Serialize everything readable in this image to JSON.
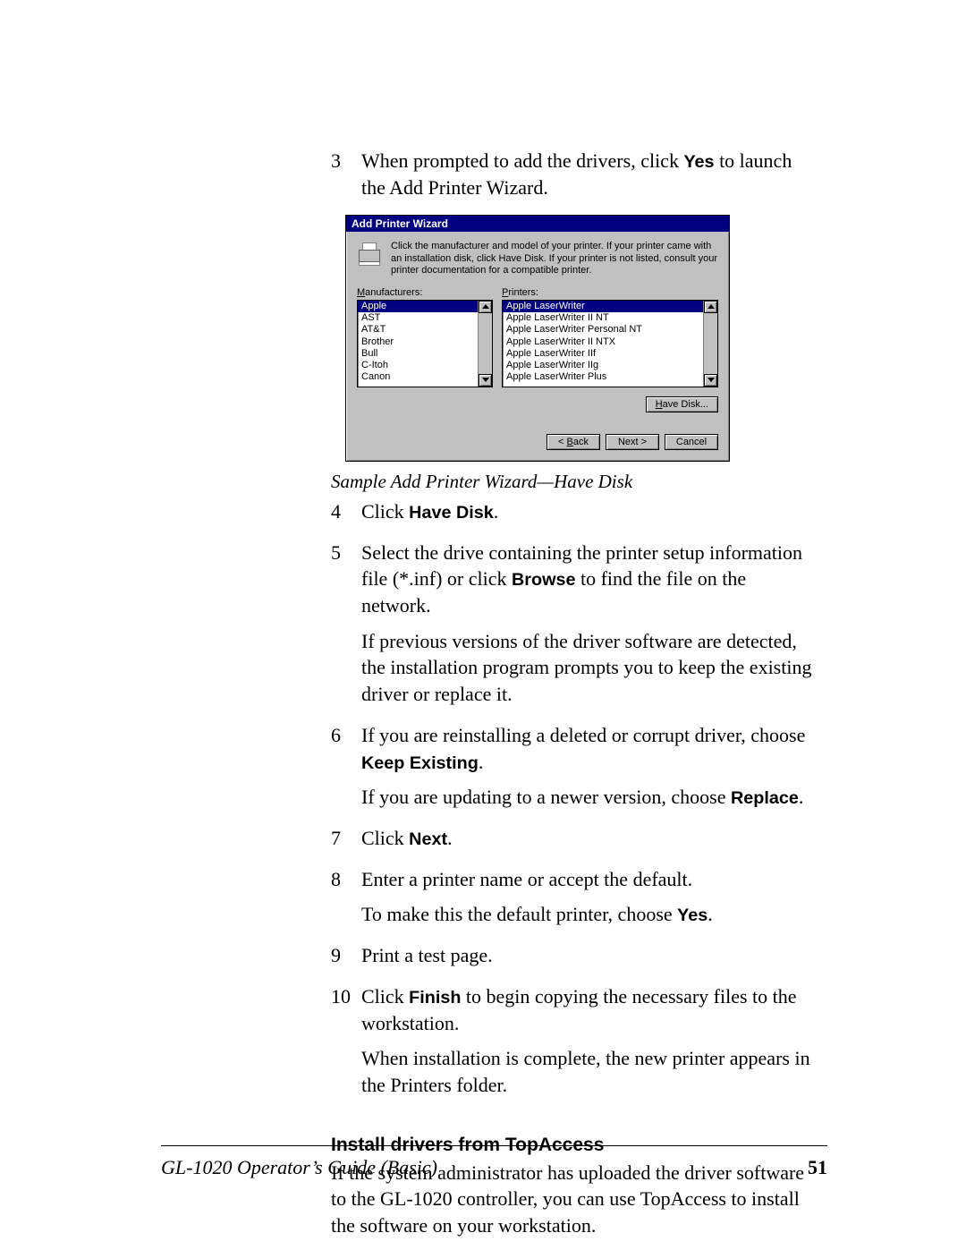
{
  "steps": {
    "s3": {
      "num": "3",
      "a": "When prompted to add the drivers, click ",
      "b": " to launch the Add Printer Wizard."
    },
    "ui_yes": "Yes",
    "caption": "Sample Add Printer Wizard—Have Disk",
    "s4": {
      "num": "4",
      "a": "Click ",
      "b": "."
    },
    "ui_havedisk": "Have Disk",
    "s5": {
      "num": "5",
      "a": " Select the drive containing the printer setup information file (*.inf) or click ",
      "b": " to find the file on the network."
    },
    "ui_browse": "Browse",
    "s5_follow": "If previous versions of the driver software are detected, the installation program prompts you to keep the existing driver or replace it.",
    "s6": {
      "num": "6",
      "a": "If you are reinstalling a deleted or corrupt driver, choose ",
      "b": "."
    },
    "ui_keep": "Keep Existing",
    "s6_follow_a": "If you are updating to a newer version, choose ",
    "s6_follow_b": ".",
    "ui_replace": "Replace",
    "s7": {
      "num": "7",
      "a": "Click ",
      "b": "."
    },
    "ui_next": "Next",
    "s8": {
      "num": "8",
      "a": "Enter a printer name or accept the default."
    },
    "s8_follow_a": "To make this the default printer, choose ",
    "s8_follow_b": ".",
    "s9": {
      "num": "9",
      "a": "Print a test page."
    },
    "s10": {
      "num": "10",
      "a": "Click ",
      "b": " to begin copying the necessary files to the workstation."
    },
    "ui_finish": "Finish",
    "s10_follow": "When installation is complete, the new printer appears in the Printers folder."
  },
  "section": {
    "heading": "Install drivers from TopAccess",
    "body": "If the system administrator has uploaded the driver software to the GL-1020 controller, you can use TopAccess to install the software on your workstation."
  },
  "dialog": {
    "title": "Add Printer Wizard",
    "instruction": "Click the manufacturer and model of your printer. If your printer came with an installation disk, click Have Disk. If your printer is not listed, consult your printer documentation for a compatible printer.",
    "manu_label_pre": "M",
    "manu_label_post": "anufacturers:",
    "prn_label_pre": "P",
    "prn_label_post": "rinters:",
    "manufacturers": [
      "Apple",
      "AST",
      "AT&T",
      "Brother",
      "Bull",
      "C-Itoh",
      "Canon"
    ],
    "printers": [
      "Apple LaserWriter",
      "Apple LaserWriter II NT",
      "Apple LaserWriter Personal NT",
      "Apple LaserWriter II NTX",
      "Apple LaserWriter IIf",
      "Apple LaserWriter IIg",
      "Apple LaserWriter Plus"
    ],
    "btn_havedisk_pre": "H",
    "btn_havedisk_post": "ave Disk...",
    "btn_back": "< Back",
    "btn_back_u": "B",
    "btn_next": "Next >",
    "btn_cancel": "Cancel"
  },
  "footer": {
    "left": "GL-1020 Operator’s Guide (Basic)",
    "right": "51"
  }
}
